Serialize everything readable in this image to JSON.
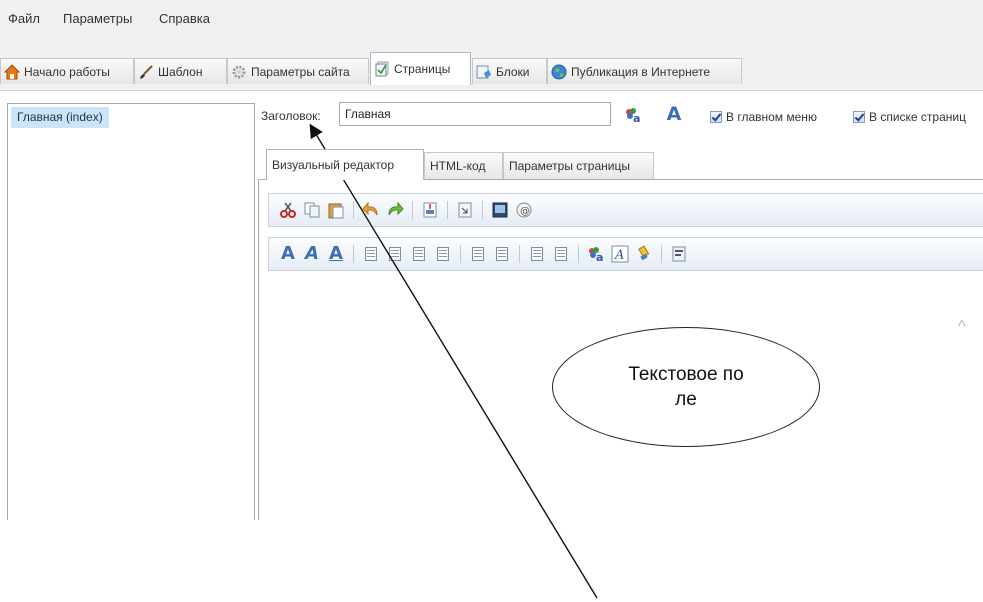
{
  "menu": [
    "Файл",
    "Параметры",
    "Справка"
  ],
  "tabs": [
    {
      "label": "Начало работы",
      "icon": "home-icon"
    },
    {
      "label": "Шаблон",
      "icon": "brush-icon"
    },
    {
      "label": "Параметры сайта",
      "icon": "gear-icon"
    },
    {
      "label": "Страницы",
      "icon": "pages-icon",
      "active": true
    },
    {
      "label": "Блоки",
      "icon": "blocks-icon"
    },
    {
      "label": "Публикация в Интернете",
      "icon": "globe-icon"
    }
  ],
  "pages_list": [
    "Главная (index)"
  ],
  "page_title": {
    "label": "Заголовок:",
    "value": "Главная"
  },
  "checkboxes": [
    {
      "label": "В главном меню",
      "checked": true
    },
    {
      "label": "В списке страниц",
      "checked": true
    }
  ],
  "editor_tabs": [
    {
      "label": "Визуальный редактор",
      "active": true
    },
    {
      "label": "HTML-код"
    },
    {
      "label": "Параметры страницы"
    }
  ],
  "toolbar1_icons": [
    "cut-icon",
    "copy-icon",
    "paste-icon",
    "undo-icon",
    "redo-icon",
    "insert-image-icon",
    "insert-file-icon",
    "media-icon",
    "special-char-icon"
  ],
  "toolbar2_icons": [
    "font-bold-icon",
    "font-italic-icon",
    "font-underline-icon",
    "align-left-icon",
    "align-center-icon",
    "align-right-icon",
    "align-justify-icon",
    "ordered-list-icon",
    "unordered-list-icon",
    "outdent-icon",
    "indent-icon",
    "text-color-icon",
    "font-style-icon",
    "clear-format-icon",
    "html-source-icon"
  ],
  "annotation": {
    "text": "Текстовое поле"
  },
  "colors": {
    "accent": "#3a6fb2",
    "selection": "#cde3f7",
    "toolbar": "#e6edf5"
  }
}
